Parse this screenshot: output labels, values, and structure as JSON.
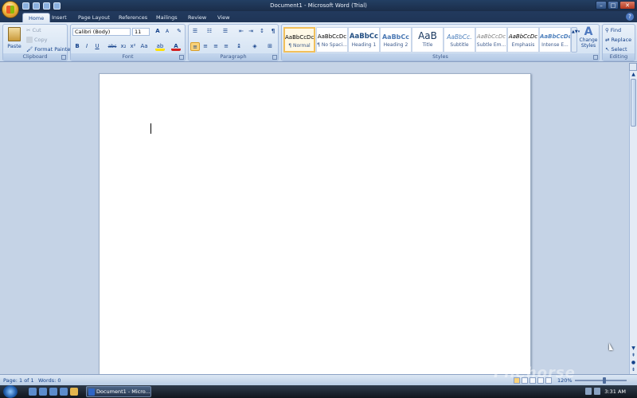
{
  "window": {
    "title": "Document1 - Microsoft Word (Trial)",
    "minimize": "–",
    "maximize": "□",
    "close": "✕",
    "help": "?"
  },
  "qat": {
    "items": [
      "save-icon",
      "undo-icon",
      "redo-icon",
      "customize-icon"
    ]
  },
  "tabs": [
    "Home",
    "Insert",
    "Page Layout",
    "References",
    "Mailings",
    "Review",
    "View"
  ],
  "active_tab": "Home",
  "ribbon": {
    "clipboard": {
      "label": "Clipboard",
      "paste": "Paste",
      "cut": "Cut",
      "copy": "Copy",
      "format_painter": "Format Painter"
    },
    "font": {
      "label": "Font",
      "font_name": "Calibri (Body)",
      "font_size": "11",
      "bold": "B",
      "italic": "I",
      "underline": "U",
      "strikethrough": "abc",
      "subscript": "x₂",
      "superscript": "x²",
      "change_case": "Aa",
      "grow": "A",
      "shrink": "A",
      "clear": "✎",
      "highlight_color": "#ffe100",
      "font_color": "#d32020"
    },
    "paragraph": {
      "label": "Paragraph"
    },
    "styles": {
      "label": "Styles",
      "items": [
        {
          "sample": "AaBbCcDc",
          "name": "¶ Normal"
        },
        {
          "sample": "AaBbCcDc",
          "name": "¶ No Spaci..."
        },
        {
          "sample": "AaBbCc",
          "name": "Heading 1"
        },
        {
          "sample": "AaBbCc",
          "name": "Heading 2"
        },
        {
          "sample": "AaB",
          "name": "Title"
        },
        {
          "sample": "AaBbCc.",
          "name": "Subtitle"
        },
        {
          "sample": "AaBbCcDc",
          "name": "Subtle Em..."
        },
        {
          "sample": "AaBbCcDc",
          "name": "Emphasis"
        },
        {
          "sample": "AaBbCcDc",
          "name": "Intense E..."
        }
      ],
      "change_styles": "Change Styles"
    },
    "editing": {
      "label": "Editing",
      "find": "Find",
      "replace": "Replace",
      "select": "Select"
    }
  },
  "status": {
    "page": "Page: 1 of 1",
    "words": "Words: 0",
    "zoom": "120%",
    "zoom_level_fraction": 0.58
  },
  "taskbar": {
    "task": "Document1 - Micro...",
    "clock": "3:31 AM"
  },
  "watermark": "Filehorse"
}
